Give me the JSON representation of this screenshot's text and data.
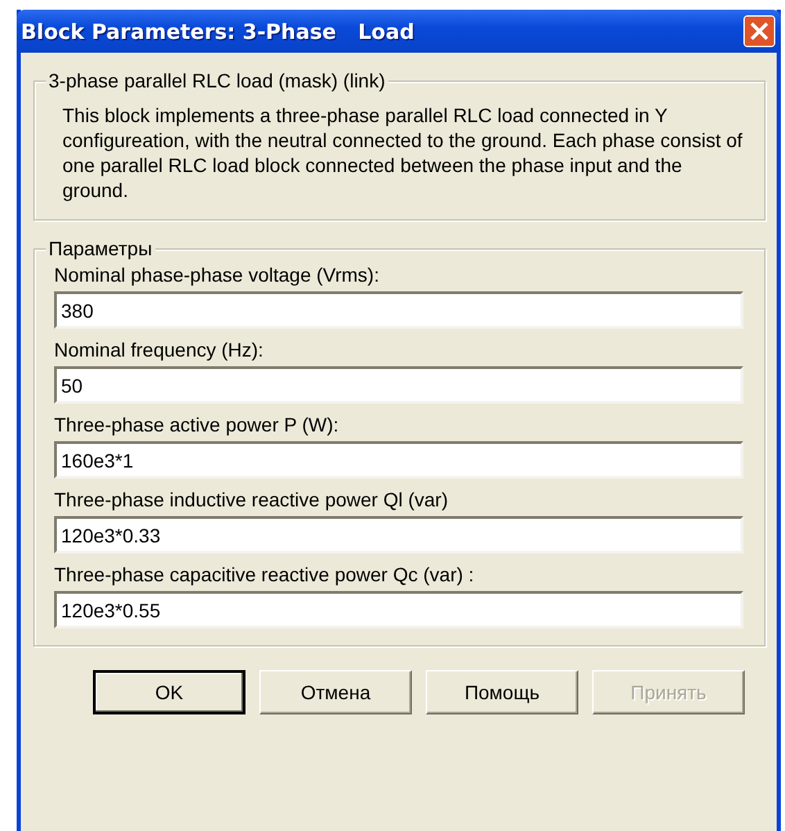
{
  "window": {
    "title": "Block Parameters: 3-Phase   Load"
  },
  "description": {
    "title": "3-phase parallel RLC load  (mask) (link)",
    "text": "This block implements a three-phase parallel RLC load connected in Y configureation, with the neutral connected to the ground. Each phase consist of one parallel RLC load block connected between the phase input and the ground."
  },
  "parameters": {
    "title": "Параметры",
    "fields": [
      {
        "label": "Nominal phase-phase voltage (Vrms):",
        "value": "380"
      },
      {
        "label": "Nominal frequency (Hz):",
        "value": "50"
      },
      {
        "label": "Three-phase active power P (W):",
        "value": "160e3*1"
      },
      {
        "label": "Three-phase inductive reactive power Ql (var)",
        "value": "120e3*0.33"
      },
      {
        "label": "Three-phase capacitive reactive power Qc (var) :",
        "value": "120e3*0.55"
      }
    ]
  },
  "buttons": [
    {
      "label": "OK",
      "default": true,
      "disabled": false
    },
    {
      "label": "Отмена",
      "default": false,
      "disabled": false
    },
    {
      "label": "Помощь",
      "default": false,
      "disabled": false
    },
    {
      "label": "Принять",
      "default": false,
      "disabled": true
    }
  ]
}
